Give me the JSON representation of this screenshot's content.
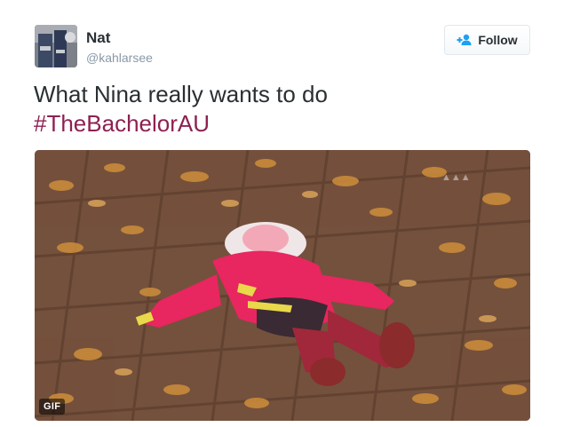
{
  "user": {
    "name": "Nat",
    "handle": "@kahlarsee"
  },
  "follow_button": {
    "label": "Follow",
    "icon": "add-user-icon"
  },
  "tweet": {
    "text": "What Nina really wants to do",
    "hashtag": "#TheBachelorAU"
  },
  "media": {
    "badge": "GIF",
    "description_icon": "gif-media"
  },
  "colors": {
    "hashtag": "#8e2151",
    "follow_icon": "#1da1f2",
    "name": "#292f33",
    "handle": "#8899a6"
  }
}
